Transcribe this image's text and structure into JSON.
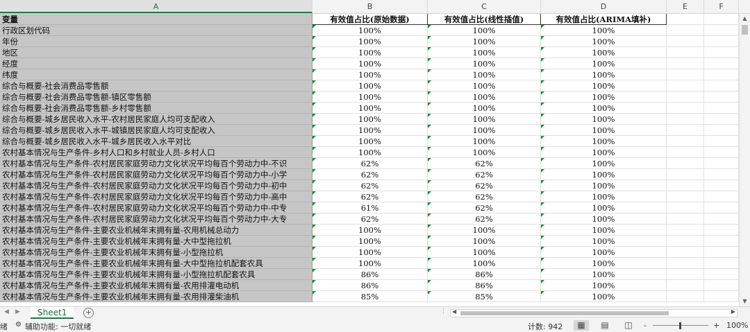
{
  "columns": [
    "A",
    "B",
    "C",
    "D",
    "E",
    "F"
  ],
  "header": {
    "a": "变量",
    "b": "有效值占比(原始数据)",
    "c": "有效值占比(线性插值)",
    "d": "有效值占比(ARIMA填补)"
  },
  "rows": [
    {
      "a": "行政区划代码",
      "b": "100%",
      "c": "100%",
      "d": "100%"
    },
    {
      "a": "年份",
      "b": "100%",
      "c": "100%",
      "d": "100%"
    },
    {
      "a": "地区",
      "b": "100%",
      "c": "100%",
      "d": "100%"
    },
    {
      "a": "经度",
      "b": "100%",
      "c": "100%",
      "d": "100%"
    },
    {
      "a": "纬度",
      "b": "100%",
      "c": "100%",
      "d": "100%"
    },
    {
      "a": "综合与概要-社会消费品零售额",
      "b": "100%",
      "c": "100%",
      "d": "100%"
    },
    {
      "a": "综合与概要-社会消费品零售额-镇区零售额",
      "b": "100%",
      "c": "100%",
      "d": "100%"
    },
    {
      "a": "综合与概要-社会消费品零售额-乡村零售额",
      "b": "100%",
      "c": "100%",
      "d": "100%"
    },
    {
      "a": "综合与概要-城乡居民收入水平-农村居民家庭人均可支配收入",
      "b": "100%",
      "c": "100%",
      "d": "100%"
    },
    {
      "a": "综合与概要-城乡居民收入水平-城镇居民家庭人均可支配收入",
      "b": "100%",
      "c": "100%",
      "d": "100%"
    },
    {
      "a": "综合与概要-城乡居民收入水平-城乡居民收入水平对比",
      "b": "100%",
      "c": "100%",
      "d": "100%"
    },
    {
      "a": "农村基本情况与生产条件-乡村人口和乡村就业人员-乡村人口",
      "b": "100%",
      "c": "100%",
      "d": "100%"
    },
    {
      "a": "农村基本情况与生产条件-农村居民家庭劳动力文化状况平均每百个劳动力中-不识",
      "b": "62%",
      "c": "62%",
      "d": "100%"
    },
    {
      "a": "农村基本情况与生产条件-农村居民家庭劳动力文化状况平均每百个劳动力中-小学",
      "b": "62%",
      "c": "62%",
      "d": "100%"
    },
    {
      "a": "农村基本情况与生产条件-农村居民家庭劳动力文化状况平均每百个劳动力中-初中",
      "b": "62%",
      "c": "62%",
      "d": "100%"
    },
    {
      "a": "农村基本情况与生产条件-农村居民家庭劳动力文化状况平均每百个劳动力中-高中",
      "b": "62%",
      "c": "62%",
      "d": "100%"
    },
    {
      "a": "农村基本情况与生产条件-农村居民家庭劳动力文化状况平均每百个劳动力中-中专",
      "b": "61%",
      "c": "62%",
      "d": "100%"
    },
    {
      "a": "农村基本情况与生产条件-农村居民家庭劳动力文化状况平均每百个劳动力中-大专",
      "b": "62%",
      "c": "62%",
      "d": "100%"
    },
    {
      "a": "农村基本情况与生产条件-主要农业机械年末拥有量-农用机械总动力",
      "b": "100%",
      "c": "100%",
      "d": "100%"
    },
    {
      "a": "农村基本情况与生产条件-主要农业机械年末拥有量-大中型拖拉机",
      "b": "100%",
      "c": "100%",
      "d": "100%"
    },
    {
      "a": "农村基本情况与生产条件-主要农业机械年末拥有量-小型拖拉机",
      "b": "100%",
      "c": "100%",
      "d": "100%"
    },
    {
      "a": "农村基本情况与生产条件-主要农业机械年末拥有量-大中型拖拉机配套农具",
      "b": "100%",
      "c": "100%",
      "d": "100%"
    },
    {
      "a": "农村基本情况与生产条件-主要农业机械年末拥有量-小型拖拉机配套农具",
      "b": "86%",
      "c": "86%",
      "d": "100%"
    },
    {
      "a": "农村基本情况与生产条件-主要农业机械年末拥有量-农用排灌电动机",
      "b": "86%",
      "c": "86%",
      "d": "100%"
    },
    {
      "a": "农村基本情况与生产条件-主要农业机械年末拥有量-农用排灌柴油机",
      "b": "85%",
      "c": "85%",
      "d": "100%"
    }
  ],
  "sheet_tab": "Sheet1",
  "status": {
    "left_fragment": "绪",
    "accessibility": "辅助功能: 一切就绪",
    "count": "计数: 942",
    "zoom": "100%",
    "zoom_minus": "-",
    "zoom_plus": "+"
  },
  "icons": {
    "view_normal": "grid-icon",
    "view_layout": "page-layout-icon",
    "view_break": "page-break-icon"
  }
}
